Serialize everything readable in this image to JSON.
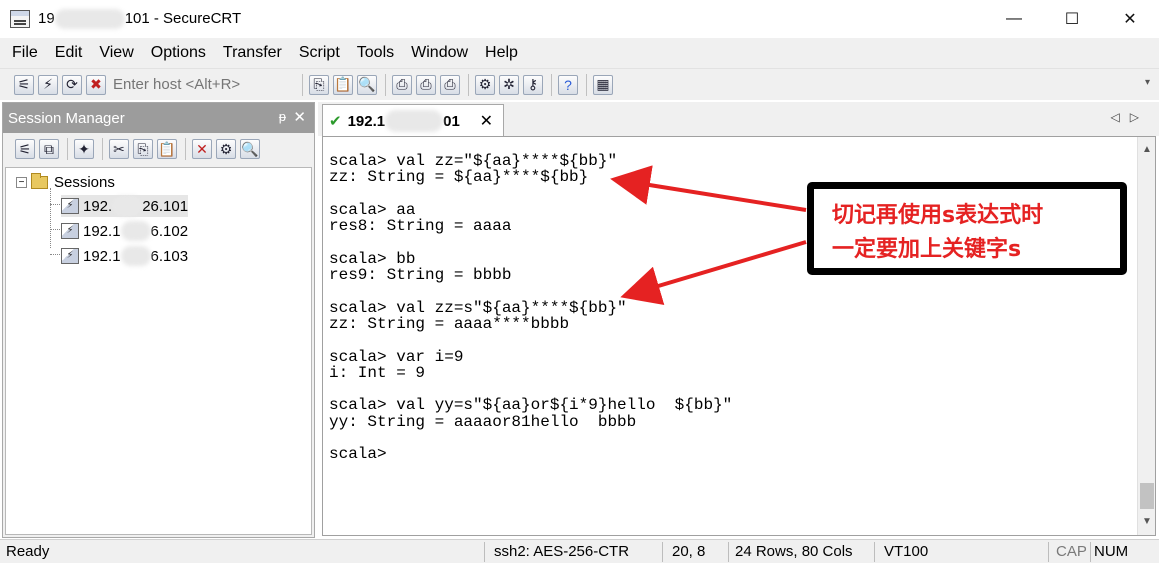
{
  "window": {
    "title_prefix": "19",
    "title_suffix": "101 - SecureCRT",
    "minimize": "—",
    "maximize": "☐",
    "close": "✕"
  },
  "menu": [
    "File",
    "Edit",
    "View",
    "Options",
    "Transfer",
    "Script",
    "Tools",
    "Window",
    "Help"
  ],
  "toolbar": {
    "host_placeholder": "Enter host <Alt+R>",
    "icons": [
      "connect-icon",
      "quick-connect-icon",
      "connect-tab-icon",
      "disconnect-icon",
      "copy-icon",
      "paste-icon",
      "find-icon",
      "print-icon",
      "print-selection-icon",
      "printer-icon",
      "session-options-icon",
      "global-options-icon",
      "keymap-icon",
      "help-icon",
      "screenshot-icon"
    ]
  },
  "session_manager": {
    "title": "Session Manager",
    "pin": "ᵽ",
    "close": "✕",
    "root": "Sessions",
    "toggle": "−",
    "sessions": [
      {
        "prefix": "192.",
        "suffix": "26.101"
      },
      {
        "prefix": "192.1",
        "suffix": "6.102"
      },
      {
        "prefix": "192.1",
        "suffix": "6.103"
      }
    ]
  },
  "tab": {
    "label_prefix": "192.1",
    "label_suffix": "01",
    "close": "✕",
    "status_icon": "connected-check-icon"
  },
  "terminal": {
    "lines": "scala> val zz=\"${aa}****${bb}\"\nzz: String = ${aa}****${bb}\n\nscala> aa\nres8: String = aaaa\n\nscala> bb\nres9: String = bbbb\n\nscala> val zz=s\"${aa}****${bb}\"\nzz: String = aaaa****bbbb\n\nscala> var i=9\ni: Int = 9\n\nscala> val yy=s\"${aa}or${i*9}hello  ${bb}\"\nyy: String = aaaaor81hello  bbbb\n\nscala>"
  },
  "annotation": {
    "line1": "切记再使用s表达式时",
    "line2": "一定要加上关键字s",
    "color": "#e52222"
  },
  "statusbar": {
    "ready": "Ready",
    "cipher": "ssh2: AES-256-CTR",
    "cursor": "20,   8",
    "size": "24 Rows, 80 Cols",
    "emulation": "VT100",
    "cap": "CAP",
    "num": "NUM"
  }
}
